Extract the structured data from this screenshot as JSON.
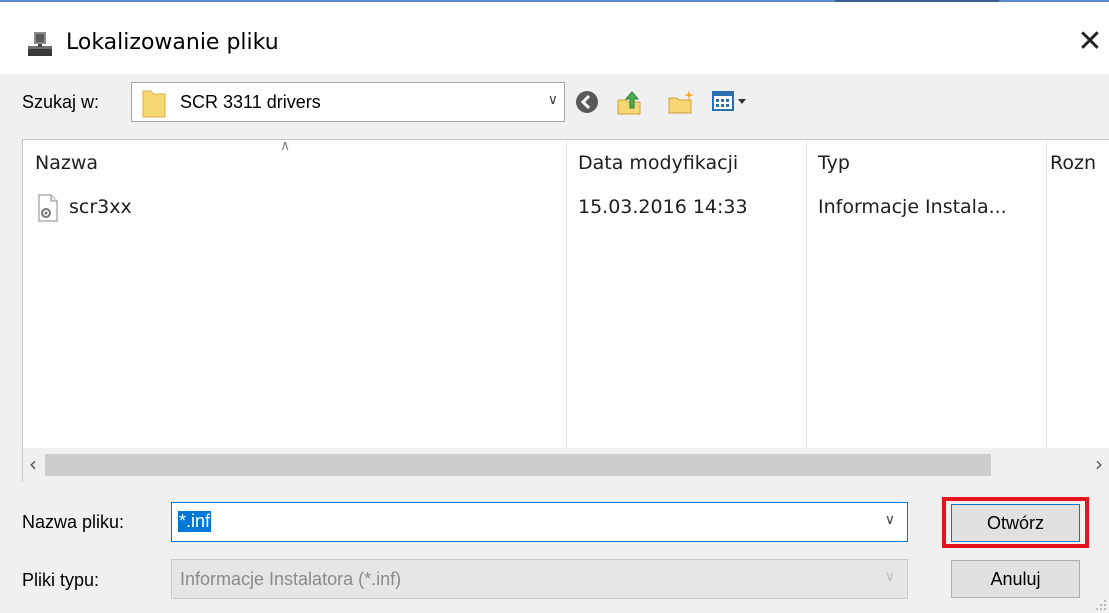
{
  "window": {
    "title": "Lokalizowanie pliku",
    "close_glyph": "✕"
  },
  "lookin": {
    "label": "Szukaj w:",
    "value": "SCR 3311 drivers"
  },
  "toolbar": {
    "icons": [
      "back-icon",
      "up-folder-icon",
      "new-folder-icon",
      "view-menu-icon"
    ]
  },
  "list": {
    "columns": [
      "Nazwa",
      "Data modyfikacji",
      "Typ",
      "Rozn"
    ],
    "rows": [
      {
        "name": "scr3xx",
        "modified": "15.03.2016 14:33",
        "type": "Informacje Instala..."
      }
    ]
  },
  "filename": {
    "label": "Nazwa pliku:",
    "value": "*.inf"
  },
  "filetype": {
    "label": "Pliki typu:",
    "value": "Informacje Instalatora (*.inf)"
  },
  "buttons": {
    "open": "Otwórz",
    "cancel": "Anuluj"
  },
  "colors": {
    "selection": "#0078d7",
    "highlight_box": "#e3131f",
    "folder": "#f7d774"
  }
}
